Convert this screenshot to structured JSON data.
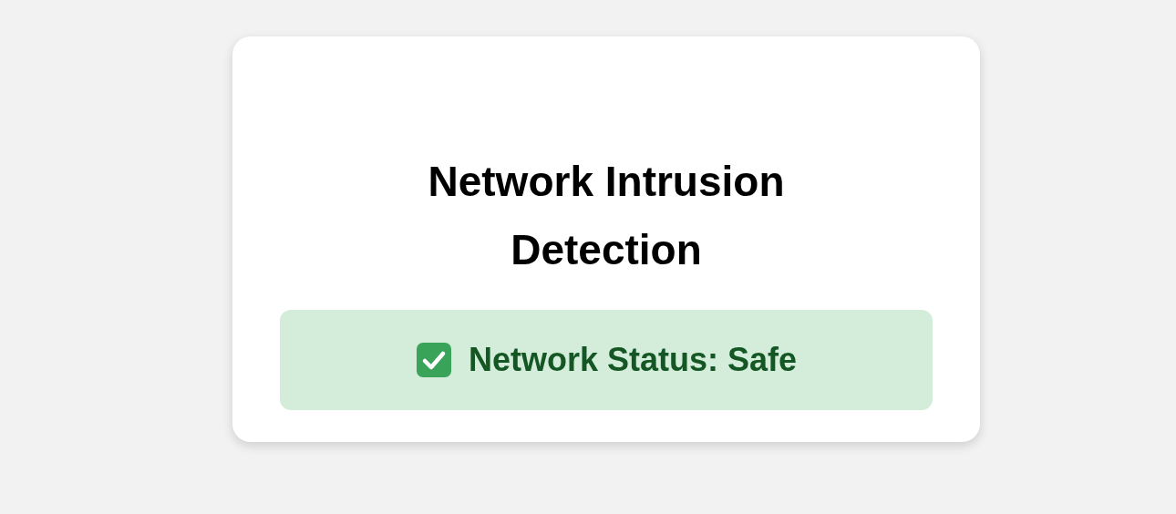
{
  "title": "Network Intrusion Detection",
  "status": {
    "kind": "safe",
    "label": "Network Status: Safe"
  }
}
